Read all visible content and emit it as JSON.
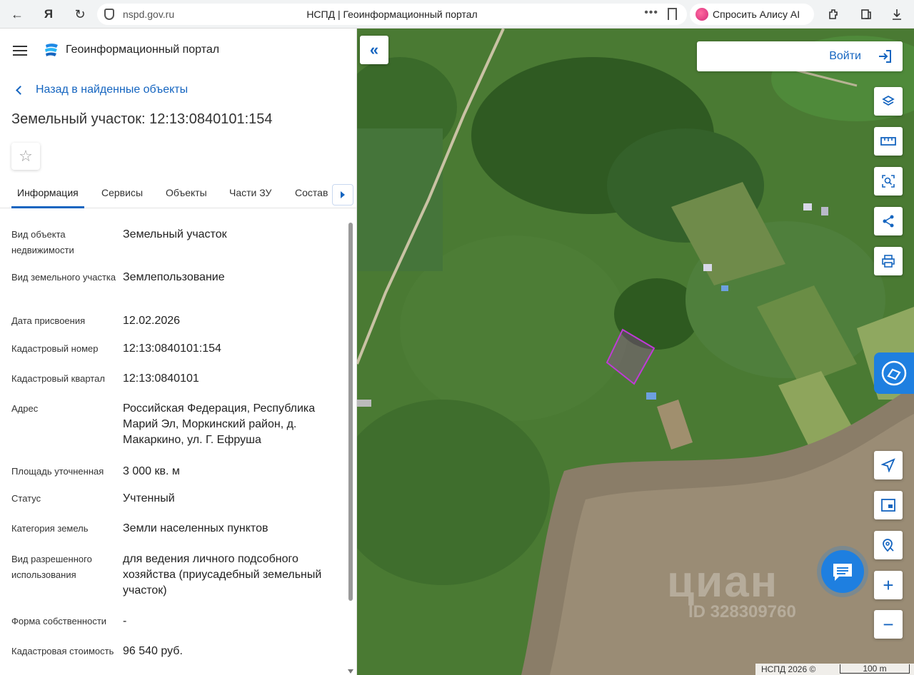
{
  "browser": {
    "url": "nspd.gov.ru",
    "tab_title": "НСПД | Геоинформационный портал",
    "dots": "•••",
    "alice_label": "Спросить Алису AI"
  },
  "header": {
    "app_title": "Геоинформационный портал"
  },
  "back_link": "Назад в найденные объекты",
  "object_title": "Земельный участок: 12:13:0840101:154",
  "favorite_icon": "☆",
  "tabs": [
    {
      "label": "Информация",
      "active": true
    },
    {
      "label": "Сервисы",
      "active": false
    },
    {
      "label": "Объекты",
      "active": false
    },
    {
      "label": "Части ЗУ",
      "active": false
    },
    {
      "label": "Состав",
      "active": false
    }
  ],
  "properties": [
    {
      "key": "Вид объекта недвижимости",
      "value": "Земельный участок"
    },
    {
      "key": "Вид земельного участка",
      "value": "Землепользование"
    },
    {
      "key": "Дата присвоения",
      "value": "12.02.2026"
    },
    {
      "key": "Кадастровый номер",
      "value": "12:13:0840101:154"
    },
    {
      "key": "Кадастровый квартал",
      "value": "12:13:0840101"
    },
    {
      "key": "Адрес",
      "value": "Российская Федерация, Республика Марий Эл, Моркинский район, д. Макаркино, ул. Г. Ефруша"
    },
    {
      "key": "Площадь уточненная",
      "value": "3 000 кв. м"
    },
    {
      "key": "Статус",
      "value": "Учтенный"
    },
    {
      "key": "Категория земель",
      "value": "Земли населенных пунктов"
    },
    {
      "key": "Вид разрешенного использования",
      "value": "для ведения личного подсобного хозяйства (приусадебный земельный участок)"
    },
    {
      "key": "Форма собственности",
      "value": "-"
    },
    {
      "key": "Кадастровая стоимость",
      "value": "96 540 руб."
    }
  ],
  "map": {
    "login_label": "Войти",
    "watermark": "циан",
    "watermark_id": "ID 328309760",
    "copyright": "НСПД 2026 ©",
    "scale_label": "100 m",
    "accent": "#1565c0",
    "parcel_color": "#c03ad8"
  }
}
